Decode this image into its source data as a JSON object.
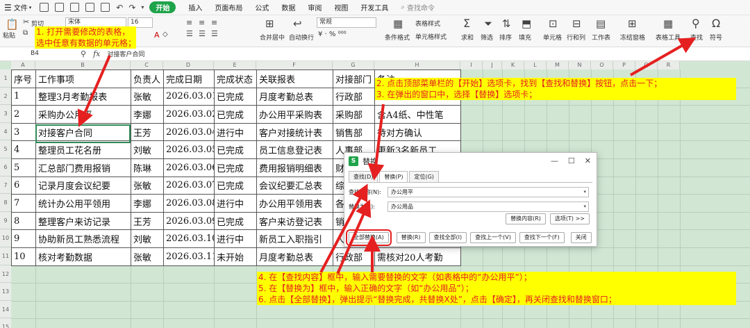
{
  "menubar": {
    "file": "文件",
    "items": [
      "开始",
      "插入",
      "页面布局",
      "公式",
      "数据",
      "审阅",
      "视图",
      "开发工具"
    ],
    "active": "开始",
    "search": "查找命令"
  },
  "ribbon": {
    "paste": "粘贴",
    "cut": "剪切",
    "font_name": "宋体",
    "font_size": "16",
    "format_box": "常规",
    "merge": "合并居中",
    "wrap": "自动换行",
    "cond_format": "条件格式",
    "table_style": "表格样式",
    "cell_style": "单元格样式",
    "sum": "求和",
    "filter": "筛选",
    "sort": "排序",
    "fill": "填充",
    "cell": "单元格",
    "rowcol": "行和列",
    "sheet": "工作表",
    "freeze": "冻结窗格",
    "tools": "表格工具",
    "find": "查找",
    "symbol": "符号"
  },
  "formulabar": {
    "namebox": "B4",
    "fx": "fx",
    "value": "对接客户合同"
  },
  "grid": {
    "columns": [
      "A",
      "B",
      "C",
      "D",
      "E",
      "F",
      "G",
      "H",
      "I",
      "J",
      "K",
      "L",
      "M",
      "N",
      "O",
      "P",
      "Q",
      "R"
    ],
    "rows": [
      "1",
      "2",
      "3",
      "4",
      "5",
      "6",
      "7",
      "8",
      "9",
      "10",
      "11",
      "12",
      "13",
      "14",
      "15"
    ],
    "header": [
      "序号",
      "工作事项",
      "负责人",
      "完成日期",
      "完成状态",
      "关联报表",
      "对接部门",
      "备注"
    ],
    "data": [
      [
        "1",
        "整理3月考勤报表",
        "张敏",
        "2026.03.01",
        "已完成",
        "月度考勤总表",
        "行政部",
        ""
      ],
      [
        "2",
        "采购办公用平",
        "李娜",
        "2026.03.02",
        "已完成",
        "办公用平采购表",
        "采购部",
        "含A4纸、中性笔"
      ],
      [
        "3",
        "对接客户合同",
        "王芳",
        "2026.03.04",
        "进行中",
        "客户对接统计表",
        "销售部",
        "待对方确认"
      ],
      [
        "4",
        "整理员工花名册",
        "刘敏",
        "2026.03.05",
        "已完成",
        "员工信息登记表",
        "人事部",
        "更新3名新员工"
      ],
      [
        "5",
        "汇总部门费用报销",
        "陈琳",
        "2026.03.06",
        "已完成",
        "费用报销明细表",
        "财务部",
        ""
      ],
      [
        "6",
        "记录月度会议纪要",
        "张敏",
        "2026.03.07",
        "已完成",
        "会议纪要汇总表",
        "综合部",
        ""
      ],
      [
        "7",
        "统计办公用平领用",
        "李娜",
        "2026.03.08",
        "进行中",
        "办公用平领用表",
        "各部门",
        ""
      ],
      [
        "8",
        "整理客户来访记录",
        "王芳",
        "2026.03.09",
        "已完成",
        "客户来访登记表",
        "销售部",
        ""
      ],
      [
        "9",
        "协助新员工熟悉流程",
        "刘敏",
        "2026.03.10",
        "进行中",
        "新员工入职指引",
        "人事部",
        ""
      ],
      [
        "10",
        "核对考勤数据",
        "张敏",
        "2026.03.11",
        "未开始",
        "月度考勤总表",
        "行政部",
        "需核对20人考勤"
      ]
    ]
  },
  "annotations": {
    "a1": "1.    打开需要修改的表格，",
    "a1b": "选中任意有数据的单元格；",
    "a2": "2.      点击顶部菜单栏的【开始】选项卡，找到【查找和替换】按钮，点击一下；",
    "a3": "3.      在弹出的窗口中，选择【替换】选项卡；",
    "a4": "4.      在【查找内容】框中，输入需要替换的文字（如表格中的“办公用平”）；",
    "a5": "5.      在【替换为】框中，输入正确的文字（如“办公用品”）；",
    "a6": "6.      点击【全部替换】，弹出提示“替换完成，共替换X处”，点击【确定】，再关闭查找和替换窗口；"
  },
  "dialog": {
    "title": "替换",
    "logo": "S",
    "tabs": [
      "查找(D)",
      "替换(P)",
      "定位(G)"
    ],
    "find_label": "查找内容(N):",
    "find_value": "办公用平",
    "replace_label": "替换为(E):",
    "replace_value": "办公用品",
    "replace_options": "替换内容(R)",
    "options": "选项(T) >>",
    "btn_replace_all": "全部替换(A)",
    "btn_replace": "替换(R)",
    "btn_find_all": "查找全部(I)",
    "btn_prev": "查找上一个(V)",
    "btn_next": "查找下一个(F)",
    "btn_close": "关闭"
  },
  "colors": {
    "accent": "#1fa34a",
    "annotation_bg": "#ffff00",
    "annotation_text": "#e52020",
    "grid_bg": "#d1e7d4"
  }
}
